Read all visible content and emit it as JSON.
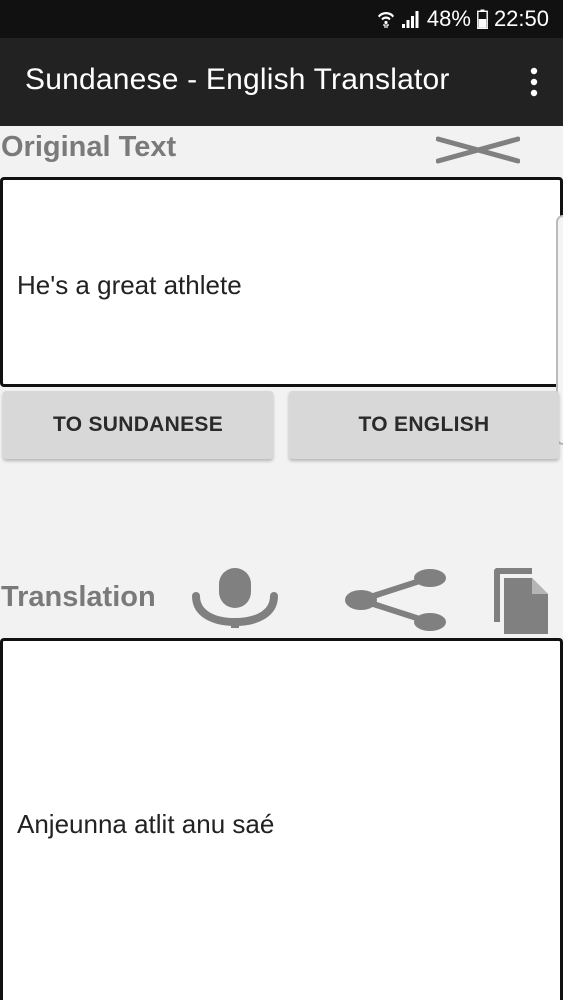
{
  "status_bar": {
    "battery": "48%",
    "time": "22:50"
  },
  "app_bar": {
    "title": "Sundanese - English Translator"
  },
  "original": {
    "label": "Original Text",
    "text": "He's a great athlete"
  },
  "buttons": {
    "to_sundanese": "TO SUNDANESE",
    "to_english": "TO ENGLISH"
  },
  "translation": {
    "label": "Translation",
    "text": "Anjeunna atlit anu saé"
  },
  "colors": {
    "app_bar": "#222222",
    "status_bar": "#111111",
    "background": "#f2f2f2",
    "label_gray": "#7a7a7a",
    "icon_gray": "#808080",
    "button_bg": "#d8d8d8"
  },
  "icons": [
    "wifi-icon",
    "signal-icon",
    "battery-icon",
    "more-vert-icon",
    "clear-icon",
    "microphone-icon",
    "share-icon",
    "copy-icon"
  ]
}
